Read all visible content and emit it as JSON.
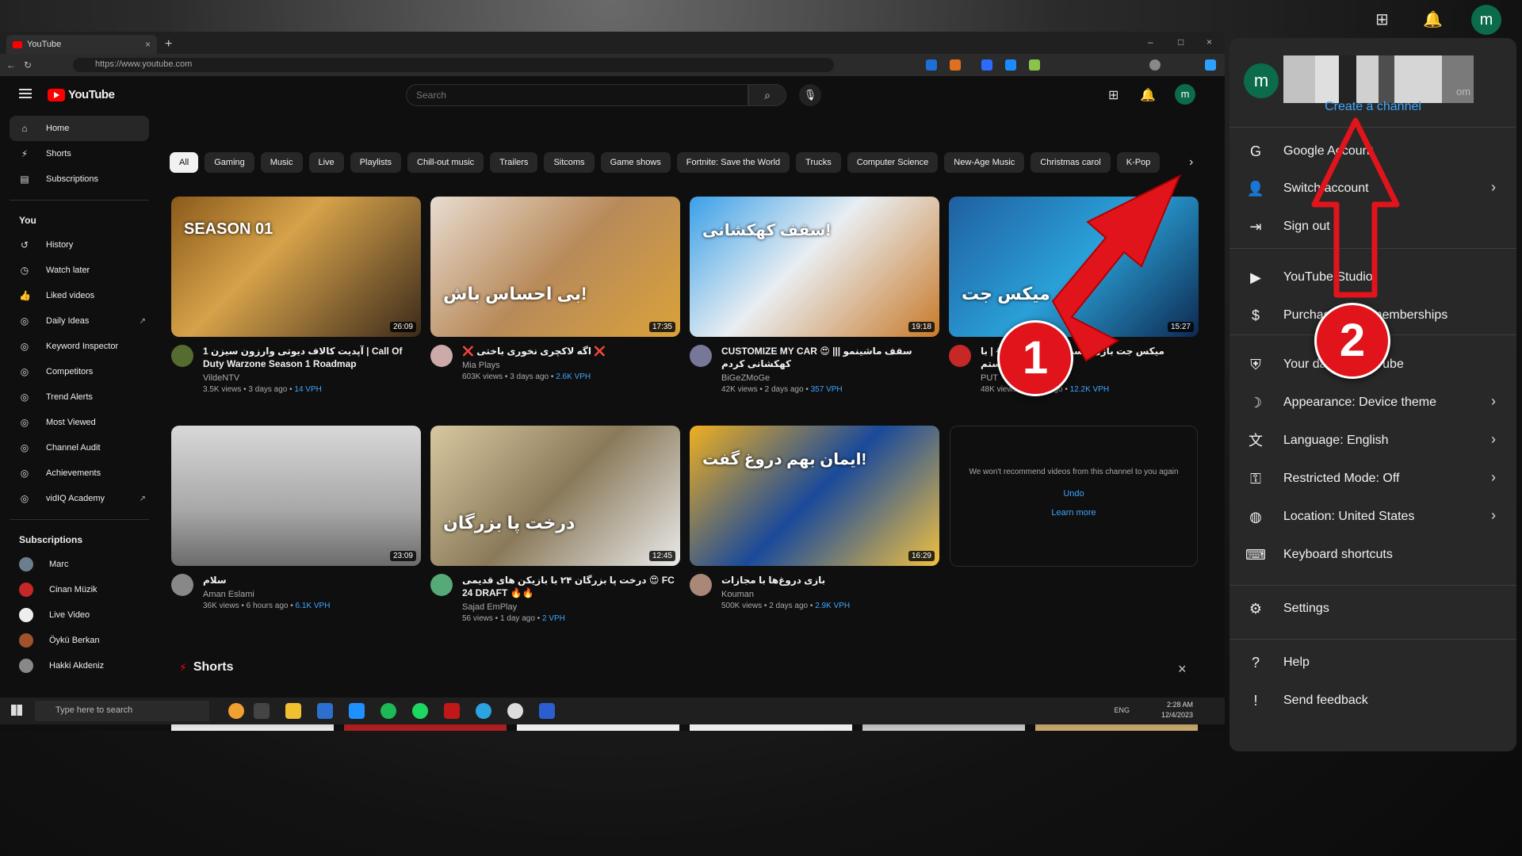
{
  "browser": {
    "tab_title": "YouTube",
    "tab_close": "×",
    "new_tab": "+",
    "url": "https://www.youtube.com",
    "win_min": "–",
    "win_max": "□",
    "win_close": "×"
  },
  "yt": {
    "logo": "YouTube",
    "search_placeholder": "Search",
    "avatar_letter": "m"
  },
  "sidebar": {
    "main": [
      {
        "label": "Home",
        "icon": "⌂"
      },
      {
        "label": "Shorts",
        "icon": "⚡"
      },
      {
        "label": "Subscriptions",
        "icon": "▤"
      }
    ],
    "you_label": "You",
    "you_items": [
      {
        "label": "History",
        "icon": "↺"
      },
      {
        "label": "Watch later",
        "icon": "◷"
      },
      {
        "label": "Liked videos",
        "icon": "👍"
      },
      {
        "label": "Daily Ideas",
        "icon": "◎"
      },
      {
        "label": "Keyword Inspector",
        "icon": "◎"
      },
      {
        "label": "Competitors",
        "icon": "◎"
      },
      {
        "label": "Trend Alerts",
        "icon": "◎"
      },
      {
        "label": "Most Viewed",
        "icon": "◎"
      },
      {
        "label": "Channel Audit",
        "icon": "◎"
      },
      {
        "label": "Achievements",
        "icon": "◎"
      },
      {
        "label": "vidIQ Academy",
        "icon": "◎"
      }
    ],
    "subs_label": "Subscriptions",
    "subs": [
      {
        "label": "Marc",
        "color": "#6b7d8f"
      },
      {
        "label": "Cinan Müzik",
        "color": "#c62828"
      },
      {
        "label": "Live Video",
        "color": "#eeeeee"
      },
      {
        "label": "Öykü Berkan",
        "color": "#a0522d"
      },
      {
        "label": "Hakki Akdeniz",
        "color": "#888888"
      }
    ]
  },
  "chips": [
    "All",
    "Gaming",
    "Music",
    "Live",
    "Playlists",
    "Chill-out music",
    "Trailers",
    "Sitcoms",
    "Game shows",
    "Fortnite: Save the World",
    "Trucks",
    "Computer Science",
    "New-Age Music",
    "Christmas carol",
    "K-Pop"
  ],
  "videos": [
    {
      "title": "1 آپدیت کالاف دیوتی وارزون سیزن | Call Of Duty Warzone Season 1 Roadmap",
      "channel": "VildeNTV",
      "stats": "3.5K views • 3 days ago • ",
      "vph": "14 VPH",
      "dur": "26:09",
      "bg": "linear-gradient(135deg,#8a5a1a,#d6a24a 40%,#3b2a1a)",
      "av": "#556b2f",
      "thumb_text": "SEASON 01"
    },
    {
      "title": "❌ اگه لاکچری نخوری باختی ❌",
      "channel": "Mia Plays",
      "stats": "603K views • 3 days ago • ",
      "vph": "2.6K VPH",
      "dur": "17:35",
      "bg": "linear-gradient(135deg,#e8dcd0,#b88a5a 50%,#d9a23a)",
      "av": "#caa",
      "thumb_text": "بی احساس باش!"
    },
    {
      "title": "CUSTOMIZE MY CAR 😍 ||| سقف ماشینمو کهکشانی کردم",
      "channel": "BiGeZMoGe",
      "stats": "42K views • 2 days ago • ",
      "vph": "357 VPH",
      "dur": "19:18",
      "bg": "linear-gradient(135deg,#3aa0e8,#e9eef2 45%,#c87a2a)",
      "av": "#779",
      "thumb_text": "سقف کهکشانی!"
    },
    {
      "title": "میکس جت بازی وسط کلاس درس 😂 | با دوستم",
      "channel": "PUT",
      "stats": "48K views • 2 days ago • ",
      "vph": "12.2K VPH",
      "dur": "15:27",
      "bg": "linear-gradient(135deg,#1f5fa0,#2aa0d8 50%,#0d2a50)",
      "av": "#c62828",
      "thumb_text": "میکس جت"
    },
    {
      "title": "سلام",
      "channel": "Aman Eslami",
      "stats": "36K views • 6 hours ago • ",
      "vph": "6.1K VPH",
      "dur": "23:09",
      "bg": "linear-gradient(180deg,#d8d8d8,#a8a8a8 60%,#6b6b6b)",
      "av": "#888",
      "thumb_text": ""
    },
    {
      "title": "درخت پا بزرگان ۲۴ با بازیکن های قدیمی 😍 FC 24 DRAFT 🔥🔥",
      "channel": "Sajad EmPlay",
      "stats": "56 views • 1 day ago • ",
      "vph": "2 VPH",
      "dur": "12:45",
      "bg": "linear-gradient(135deg,#d8c8a0,#8a7a5a 50%,#eaeaea)",
      "av": "#5a7",
      "thumb_text": "درخت پا بزرگان"
    },
    {
      "title": "بازی دروغ‌ها با مجازات",
      "channel": "Kouman",
      "stats": "500K views • 2 days ago • ",
      "vph": "2.9K VPH",
      "dur": "16:29",
      "bg": "linear-gradient(135deg,#f0b020,#1a4a9a 50%,#f0c040)",
      "av": "#a87",
      "thumb_text": "ایمان بهم دروغ گفت!"
    }
  ],
  "removed": {
    "text": "We won't recommend videos from this channel to you again",
    "undo": "Undo",
    "learn": "Learn more"
  },
  "shorts": {
    "label": "Shorts",
    "close": "×"
  },
  "taskbar": {
    "search": "Type here to search",
    "time": "2:28 AM",
    "date": "12/4/2023",
    "lang": "ENG"
  },
  "menu": {
    "avatar_letter": "m",
    "email_tail": "om",
    "create_channel": "Create a channel",
    "group1": [
      {
        "label": "Google Account",
        "icon": "G",
        "chev": false
      },
      {
        "label": "Switch account",
        "icon": "👤",
        "chev": true
      },
      {
        "label": "Sign out",
        "icon": "⇥",
        "chev": false
      }
    ],
    "group2": [
      {
        "label": "YouTube Studio",
        "icon": "▶",
        "chev": false
      },
      {
        "label": "Purchases and memberships",
        "icon": "$",
        "chev": false
      }
    ],
    "group3": [
      {
        "label": "Your data in YouTube",
        "icon": "⛨",
        "chev": false
      },
      {
        "label": "Appearance: Device theme",
        "icon": "☽",
        "chev": true
      },
      {
        "label": "Language: English",
        "icon": "文",
        "chev": true
      },
      {
        "label": "Restricted Mode: Off",
        "icon": "⚿",
        "chev": true
      },
      {
        "label": "Location: United States",
        "icon": "◍",
        "chev": true
      },
      {
        "label": "Keyboard shortcuts",
        "icon": "⌨",
        "chev": false
      }
    ],
    "group4": [
      {
        "label": "Settings",
        "icon": "⚙",
        "chev": false
      }
    ],
    "group5": [
      {
        "label": "Help",
        "icon": "?",
        "chev": false
      },
      {
        "label": "Send feedback",
        "icon": "!",
        "chev": false
      }
    ]
  },
  "annotations": {
    "step1": "1",
    "step2": "2",
    "color": "#e1141c"
  }
}
